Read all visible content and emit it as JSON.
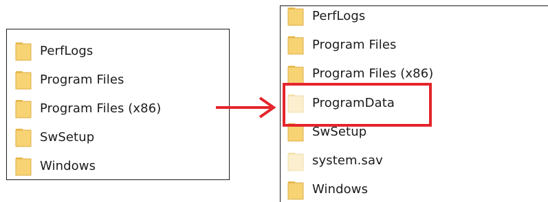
{
  "colors": {
    "folder_fill": "#f7d373",
    "folder_light": "#fbe9a9",
    "folder_hidden_fill": "#fbefcf",
    "highlight": "#e4252b",
    "arrow": "#e4252b"
  },
  "before": {
    "items": [
      {
        "label": "PerfLogs",
        "icon": "folder-icon"
      },
      {
        "label": "Program Files",
        "icon": "folder-icon"
      },
      {
        "label": "Program Files (x86)",
        "icon": "folder-icon"
      },
      {
        "label": "SwSetup",
        "icon": "folder-icon"
      },
      {
        "label": "Windows",
        "icon": "folder-icon"
      }
    ]
  },
  "after": {
    "items": [
      {
        "label": "PerfLogs",
        "icon": "folder-icon"
      },
      {
        "label": "Program Files",
        "icon": "folder-icon"
      },
      {
        "label": "Program Files (x86)",
        "icon": "folder-icon"
      },
      {
        "label": "ProgramData",
        "icon": "hidden-folder-icon",
        "highlighted": true
      },
      {
        "label": "SwSetup",
        "icon": "folder-icon"
      },
      {
        "label": "system.sav",
        "icon": "hidden-folder-icon"
      },
      {
        "label": "Windows",
        "icon": "folder-icon"
      }
    ]
  }
}
